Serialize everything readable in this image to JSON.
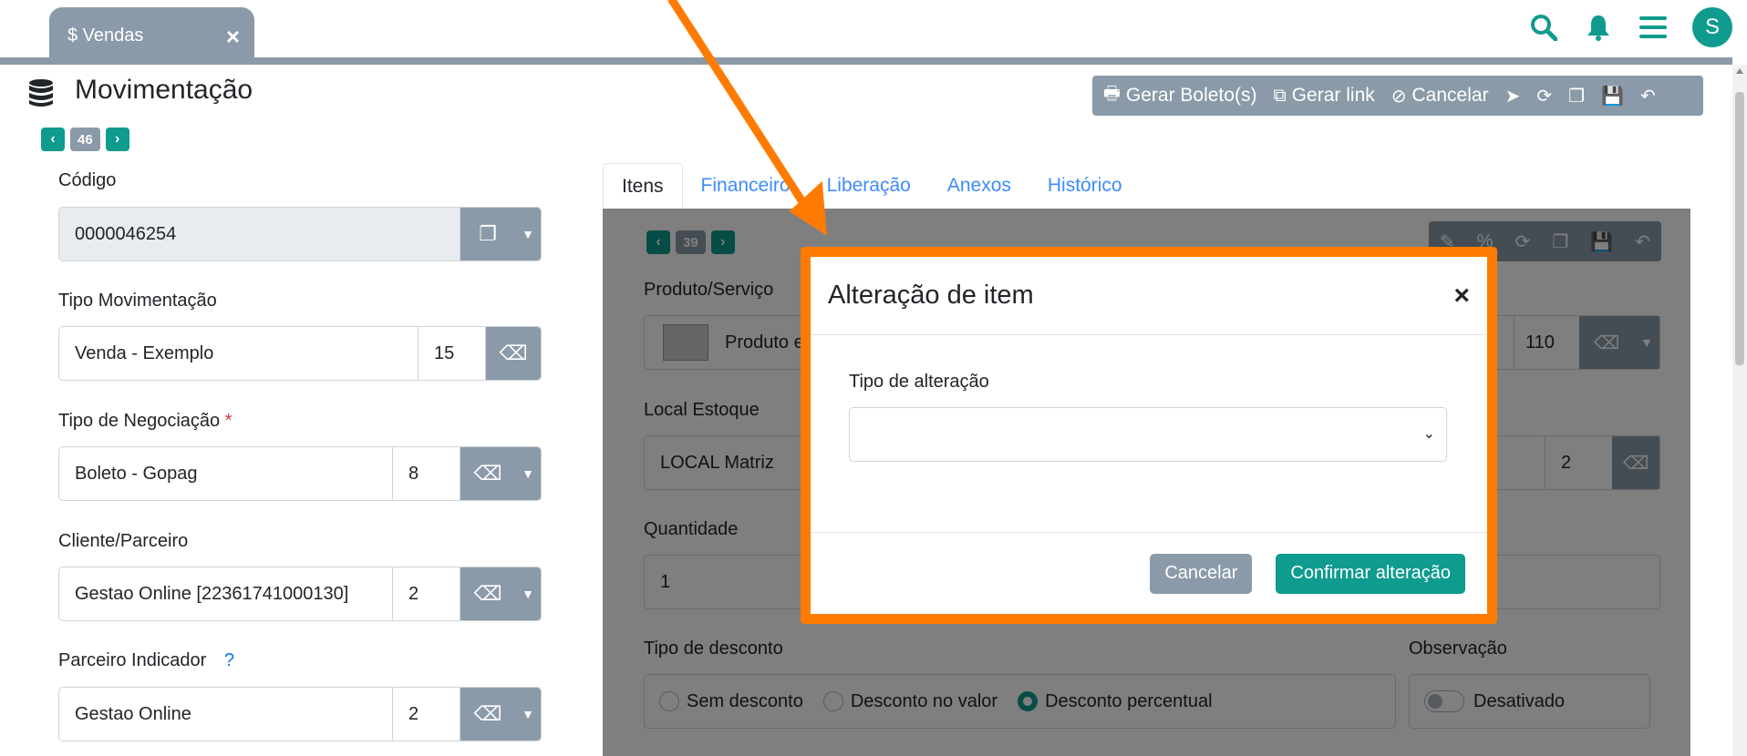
{
  "module_tab": {
    "icon": "dollar-icon",
    "label": "$ Vendas",
    "close": "×"
  },
  "header": {
    "title": "Movimentação",
    "pager": {
      "prev": "‹",
      "number": "46",
      "next": "›"
    }
  },
  "toolbar": {
    "gerar_boleto": "Gerar Boleto(s)",
    "gerar_link": "Gerar link",
    "cancelar": "Cancelar"
  },
  "form": {
    "codigo": {
      "label": "Código",
      "value": "0000046254"
    },
    "tipo_movimentacao": {
      "label": "Tipo Movimentação",
      "value": "Venda - Exemplo",
      "code": "15"
    },
    "tipo_negociacao": {
      "label": "Tipo de Negociação",
      "required": "*",
      "value": "Boleto - Gopag",
      "code": "8"
    },
    "cliente": {
      "label": "Cliente/Parceiro",
      "value": "Gestao Online [22361741000130]",
      "code": "2"
    },
    "parceiro_indicador": {
      "label": "Parceiro Indicador",
      "help": "?",
      "value": "Gestao Online",
      "code": "2"
    }
  },
  "tabs": [
    "Itens",
    "Financeiro",
    "Liberação",
    "Anexos",
    "Histórico"
  ],
  "item_panel": {
    "pager_number": "39",
    "produto_label": "Produto/Serviço",
    "produto_value": "Produto e",
    "produto_code": "110",
    "local_label": "Local Estoque",
    "local_value": "LOCAL Matriz",
    "local_code": "2",
    "quantidade_label": "Quantidade",
    "quantidade_value": "1",
    "desconto_label": "Tipo de desconto",
    "desconto_options": [
      "Sem desconto",
      "Desconto no valor",
      "Desconto percentual"
    ],
    "observacao_label": "Observação",
    "observacao_value": "Desativado"
  },
  "modal": {
    "title": "Alteração de item",
    "close": "×",
    "field_label": "Tipo de alteração",
    "select_value": "",
    "cancel": "Cancelar",
    "confirm": "Confirmar alteração"
  },
  "avatar": "S",
  "colors": {
    "teal": "#0f9b8e",
    "gray": "#8a9aa8",
    "orange": "#ff7b00"
  }
}
